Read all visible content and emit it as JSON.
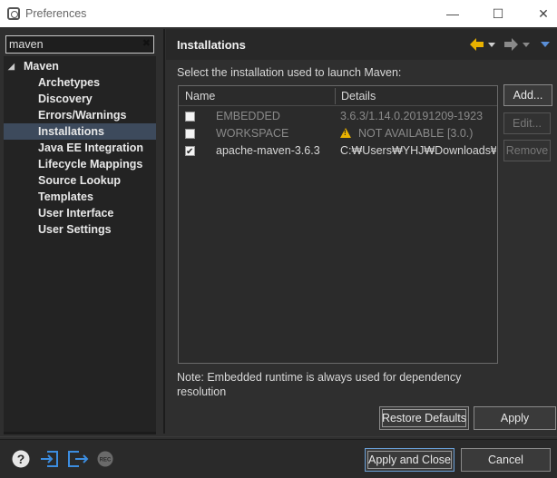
{
  "window": {
    "title": "Preferences",
    "minimize": "—",
    "maximize": "☐",
    "close": "✕"
  },
  "filter": {
    "value": "maven",
    "clear_icon": "✖"
  },
  "tree": {
    "root": {
      "label": "Maven",
      "arrow": "◢"
    },
    "items": [
      {
        "label": "Archetypes"
      },
      {
        "label": "Discovery"
      },
      {
        "label": "Errors/Warnings"
      },
      {
        "label": "Installations",
        "selected": true
      },
      {
        "label": "Java EE Integration"
      },
      {
        "label": "Lifecycle Mappings"
      },
      {
        "label": "Source Lookup"
      },
      {
        "label": "Templates"
      },
      {
        "label": "User Interface"
      },
      {
        "label": "User Settings"
      }
    ]
  },
  "page": {
    "title": "Installations",
    "description": "Select the installation used to launch Maven:",
    "nav_back_icon": "arrow-left-icon",
    "nav_forward_icon": "arrow-right-icon",
    "nav_menu_icon": "view-menu-icon"
  },
  "table": {
    "headers": {
      "name": "Name",
      "details": "Details"
    },
    "rows": [
      {
        "checked": false,
        "name": "EMBEDDED",
        "details": "3.6.3/1.14.0.20191209-1923",
        "dim": true,
        "warning": false
      },
      {
        "checked": false,
        "name": "WORKSPACE",
        "details": "NOT AVAILABLE [3.0.)",
        "dim": true,
        "warning": true
      },
      {
        "checked": true,
        "name": "apache-maven-3.6.3",
        "details": "C:₩Users₩YHJ₩Downloads₩apa",
        "dim": false,
        "warning": false
      }
    ]
  },
  "buttons": {
    "add": "Add...",
    "edit": "Edit...",
    "remove": "Remove",
    "restore_defaults": "Restore Defaults",
    "apply": "Apply",
    "apply_and_close": "Apply and Close",
    "cancel": "Cancel"
  },
  "note": "Note: Embedded runtime is always used for dependency resolution",
  "footer_icons": [
    "help-icon",
    "import-icon",
    "export-icon",
    "record-icon"
  ],
  "footer_record_label": "REC",
  "colors": {
    "accent": "#e8b100",
    "selection": "#3d4a5c",
    "default_button_border": "#6aa0d8"
  }
}
